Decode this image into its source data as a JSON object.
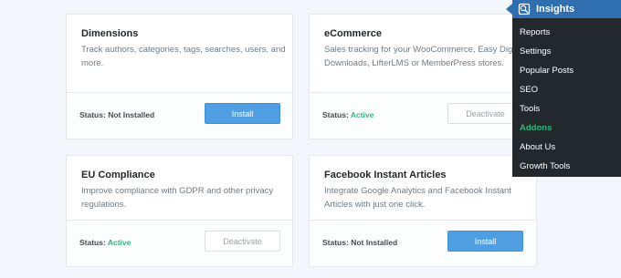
{
  "colors": {
    "accent": "#509fe2",
    "active_status": "#36b37e",
    "menu_bg": "#23282d",
    "menu_head_bg": "#2f6fb0"
  },
  "status_label": "Status:",
  "cards": [
    {
      "title": "Dimensions",
      "description": "Track authors, categories, tags, searches, users, and more.",
      "status": "Not Installed",
      "button": "Install"
    },
    {
      "title": "eCommerce",
      "description": "Sales tracking for your WooCommerce, Easy Digital Downloads, LifterLMS or MemberPress stores.",
      "status": "Active",
      "button": "Deactivate"
    },
    {
      "title": "EU Compliance",
      "description": "Improve compliance with GDPR and other privacy regulations.",
      "status": "Active",
      "button": "Deactivate"
    },
    {
      "title": "Facebook Instant Articles",
      "description": "Integrate Google Analytics and Facebook Instant Articles with just one click.",
      "status": "Not Installed",
      "button": "Install"
    }
  ],
  "menu": {
    "title": "Insights",
    "icon": "insights-icon",
    "items": [
      {
        "label": "Reports"
      },
      {
        "label": "Settings"
      },
      {
        "label": "Popular Posts"
      },
      {
        "label": "SEO"
      },
      {
        "label": "Tools"
      },
      {
        "label": "Addons",
        "current": true
      },
      {
        "label": "About Us"
      },
      {
        "label": "Growth Tools"
      }
    ]
  }
}
